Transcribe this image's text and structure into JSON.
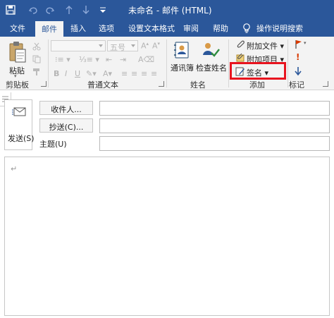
{
  "window": {
    "title": "未命名 - 邮件 (HTML)"
  },
  "quick_access": {
    "icons": [
      "save-icon",
      "undo-icon",
      "redo-icon",
      "up-arrow-icon",
      "down-arrow-icon",
      "customize-dropdown-icon"
    ]
  },
  "tabs": {
    "file": "文件",
    "mail": "邮件",
    "insert": "插入",
    "options": "选项",
    "format": "设置文本格式",
    "review": "审阅",
    "help": "帮助",
    "search": "操作说明搜索",
    "active": "邮件"
  },
  "ribbon": {
    "clipboard": {
      "paste": "粘贴",
      "label": "剪贴板"
    },
    "basic_text": {
      "font_size": "五号",
      "bold": "B",
      "italic": "I",
      "underline": "U",
      "label": "普通文本"
    },
    "names": {
      "address_book": "通讯簿",
      "check_names": "检查姓名",
      "label": "姓名"
    },
    "include": {
      "attach_file": "附加文件",
      "attach_item": "附加项目",
      "signature": "签名",
      "label": "添加"
    },
    "tags": {
      "label": "标记"
    }
  },
  "compose": {
    "send": "发送(S)",
    "to_button": "收件人...",
    "cc_button": "抄送(C)...",
    "subject_label": "主题(U)",
    "to_value": "",
    "cc_value": "",
    "subject_value": "",
    "body_mark": "↵"
  },
  "colors": {
    "title_bar": "#2b579a",
    "ribbon_bg": "#f3f3f3",
    "highlight_border": "#e8141f"
  }
}
